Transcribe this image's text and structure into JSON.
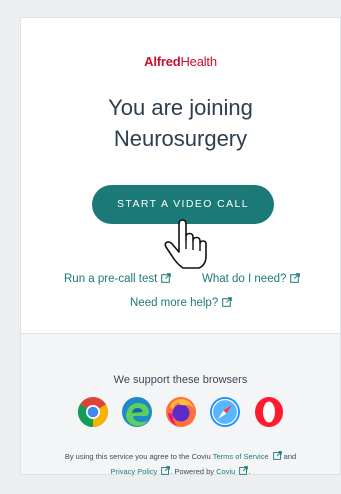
{
  "brand": {
    "part1": "Alfred",
    "part2": "Health"
  },
  "heading": {
    "line1": "You are joining",
    "line2": "Neurosurgery"
  },
  "cta": {
    "label": "START A VIDEO CALL"
  },
  "links": {
    "precall": "Run a pre-call test",
    "whatneed": "What do I need?",
    "morehelp": "Need more help?"
  },
  "footer": {
    "support_text": "We support these browsers",
    "browsers": [
      "Google Chrome",
      "Microsoft Edge",
      "Firefox",
      "Safari",
      "Opera"
    ],
    "legal": {
      "prefix": "By using this service you agree to the Coviu",
      "terms": "Terms of Service",
      "and": "and",
      "privacy": "Privacy Policy",
      "powered": ". Powered by",
      "coviu": "Coviu",
      "end": "."
    }
  },
  "colors": {
    "accent": "#1b7a78",
    "brand_red": "#c8102e",
    "text": "#2c3e50"
  }
}
